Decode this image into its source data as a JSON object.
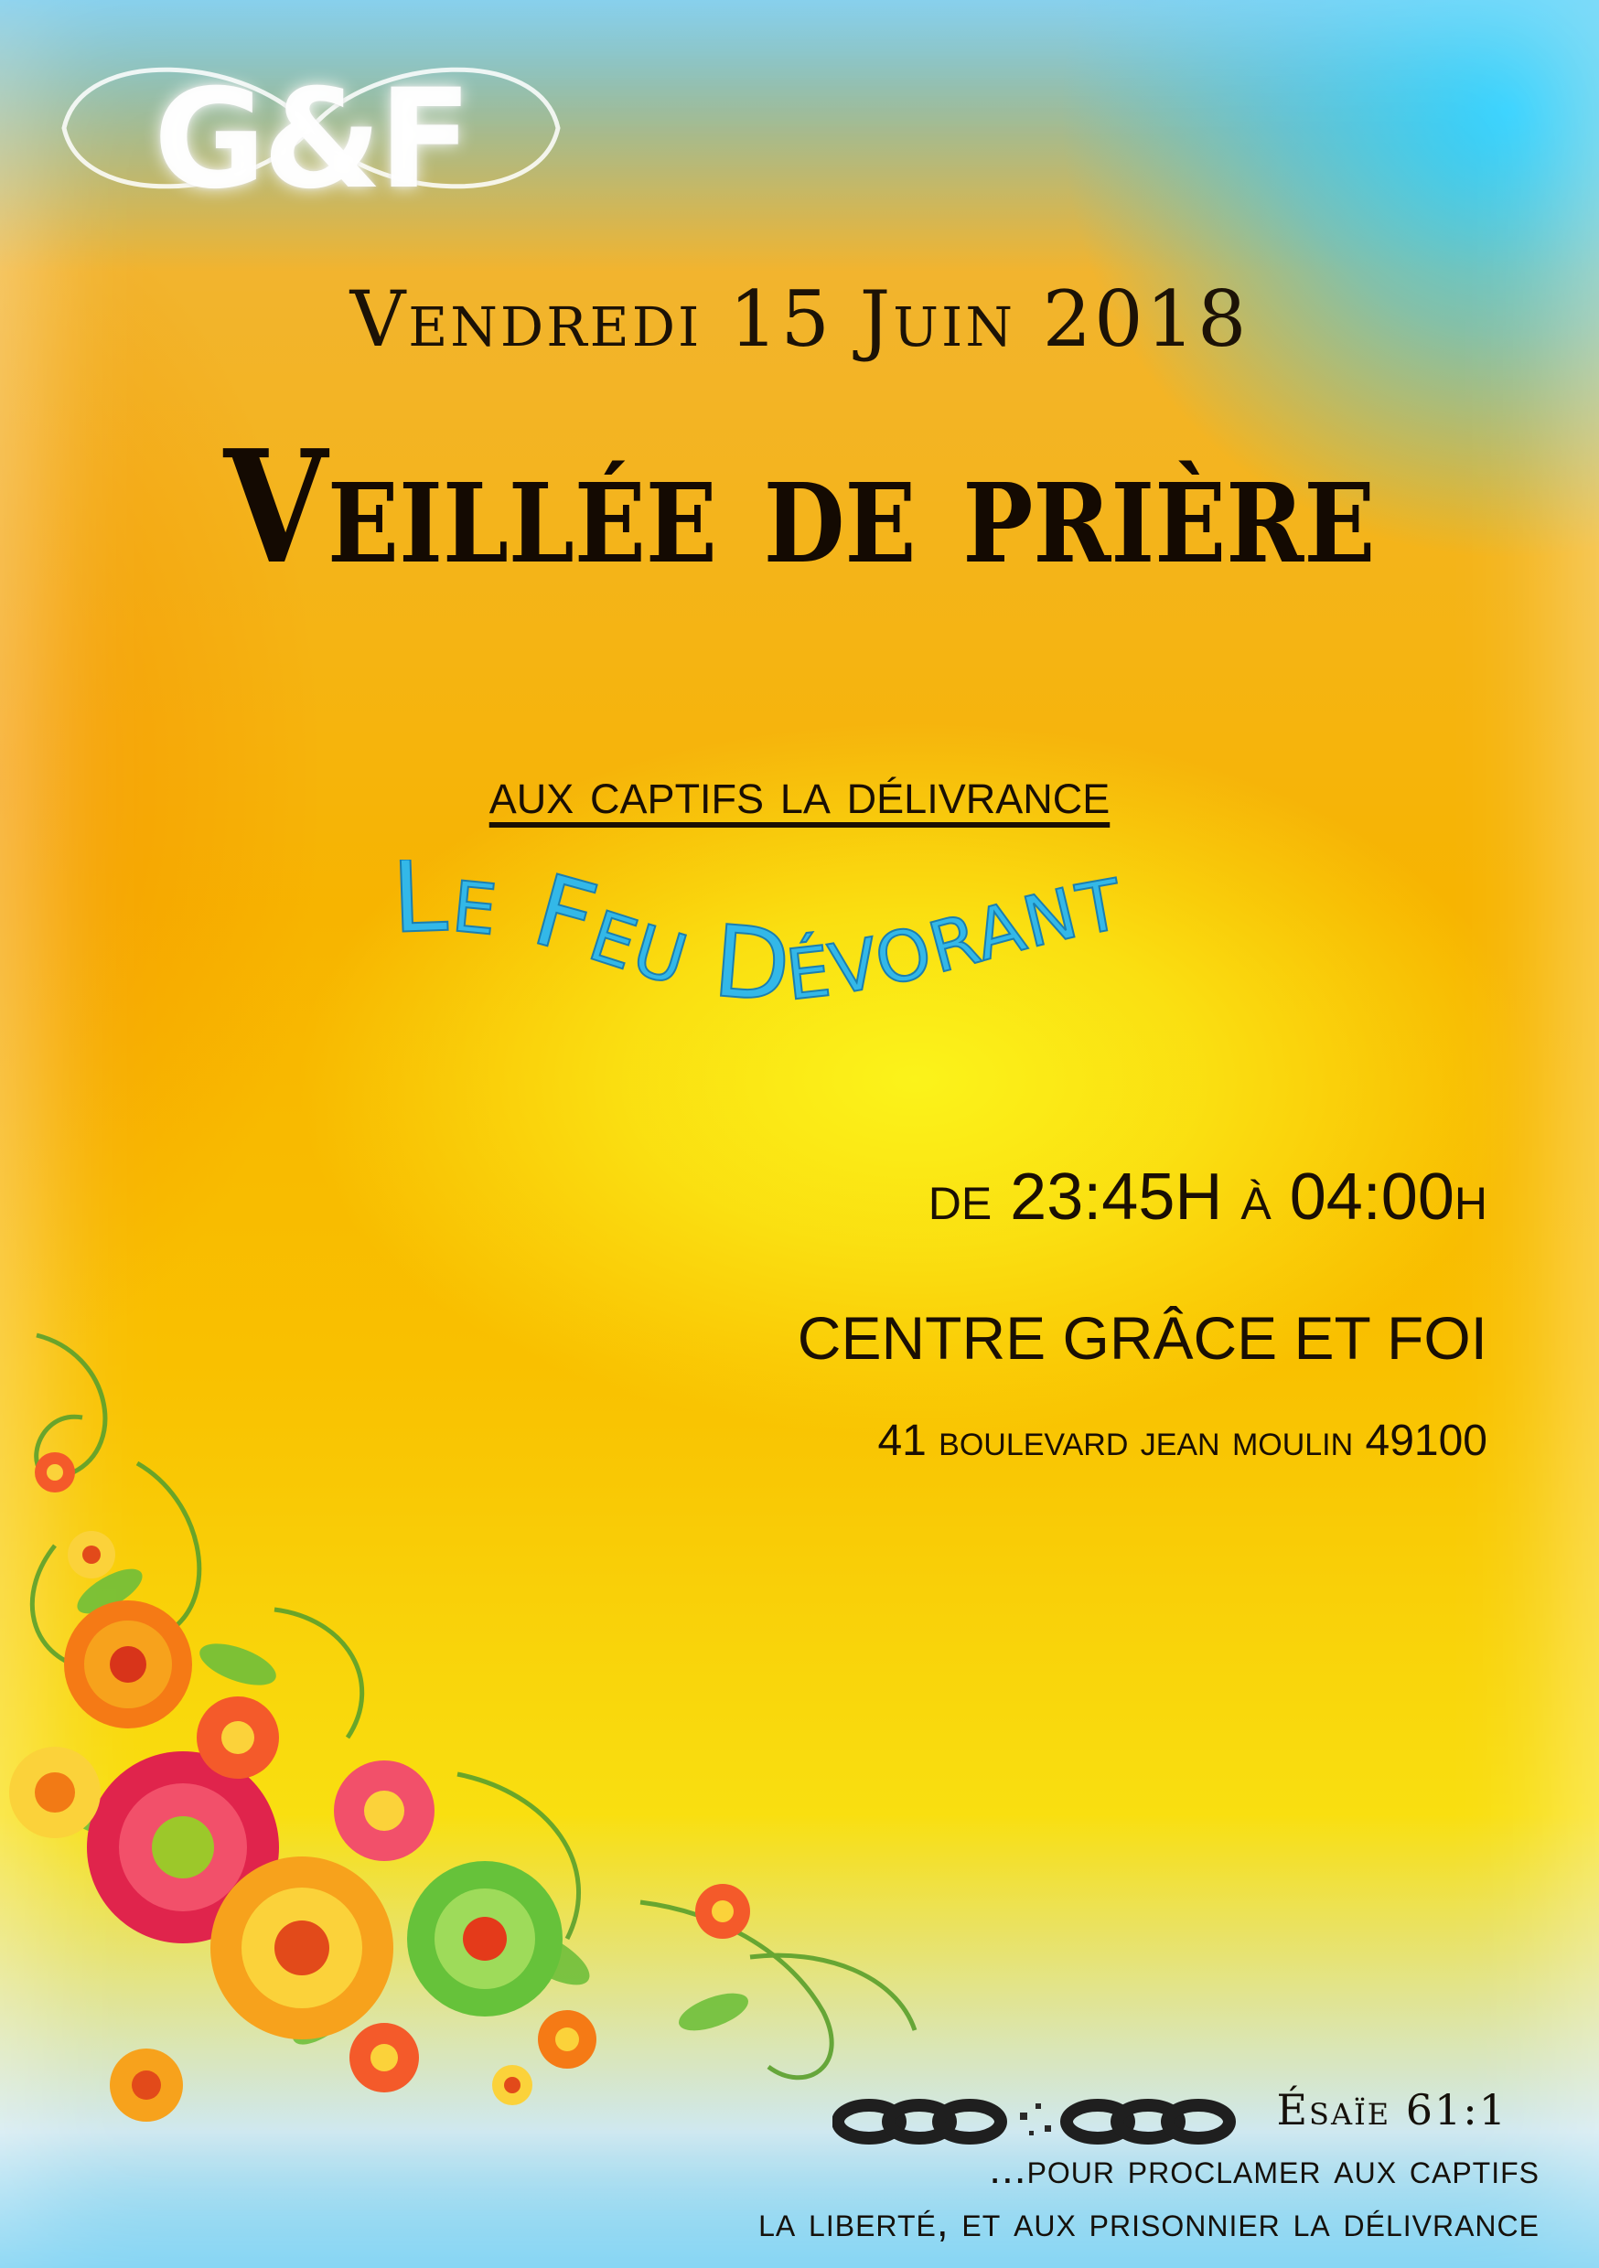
{
  "logo": {
    "text": "G&F"
  },
  "event": {
    "date": "Vendredi 15 Juin 2018",
    "title": "Veillée de prière",
    "subtitle": "aux captifs la délivrance",
    "theme": "Le Feu Dévorant",
    "time": "de 23:45H à 04:00h",
    "venue": "CENTRE GRÂCE ET FOI",
    "address": "41 boulevard jean moulin 49100"
  },
  "verse": {
    "reference": "Ésaïe 61:1",
    "line1": "...pour proclamer aux captifs",
    "line2": "la liberté, et aux prisonnier la délivrance"
  },
  "colors": {
    "background_main": "#f7b400",
    "background_center": "#fbf31a",
    "corner_blue": "#2fd1ff",
    "theme_text": "#33b8e8",
    "text_dark": "#1a0f03"
  },
  "icons": [
    "infinity-logo-icon",
    "flower-corner-icon",
    "broken-chain-icon"
  ]
}
